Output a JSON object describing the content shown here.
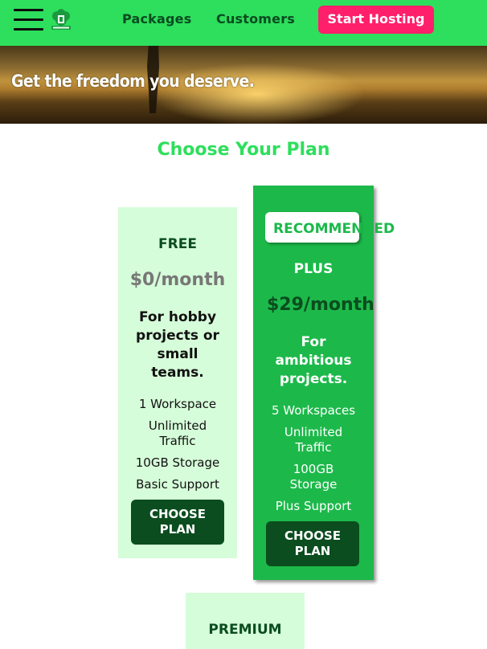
{
  "nav": {
    "packages": "Packages",
    "customers": "Customers",
    "cta": "Start Hosting"
  },
  "hero": {
    "headline": "Get the freedom you deserve."
  },
  "section": {
    "title": "Choose Your Plan"
  },
  "plans": [
    {
      "name": "FREE",
      "price": "$0/month",
      "tagline": "For hobby projects or small teams.",
      "features": [
        "1 Workspace",
        "Unlimited Traffic",
        "10GB Storage",
        "Basic Support"
      ],
      "button": "CHOOSE PLAN"
    },
    {
      "badge": "RECOMMENDED",
      "name": "PLUS",
      "price": "$29/month",
      "tagline": "For ambitious projects.",
      "features": [
        "5 Workspaces",
        "Unlimited Traffic",
        "100GB Storage",
        "Plus Support"
      ],
      "button": "CHOOSE PLAN"
    },
    {
      "name": "PREMIUM"
    }
  ],
  "colors": {
    "header": "#2ddf5c",
    "cta": "#ff1f6b",
    "accent": "#1cb94a",
    "card_light": "#d6fdd9",
    "button_dark": "#0b4d1f"
  },
  "icons": [
    "hamburger-menu-icon",
    "logo-icon"
  ]
}
